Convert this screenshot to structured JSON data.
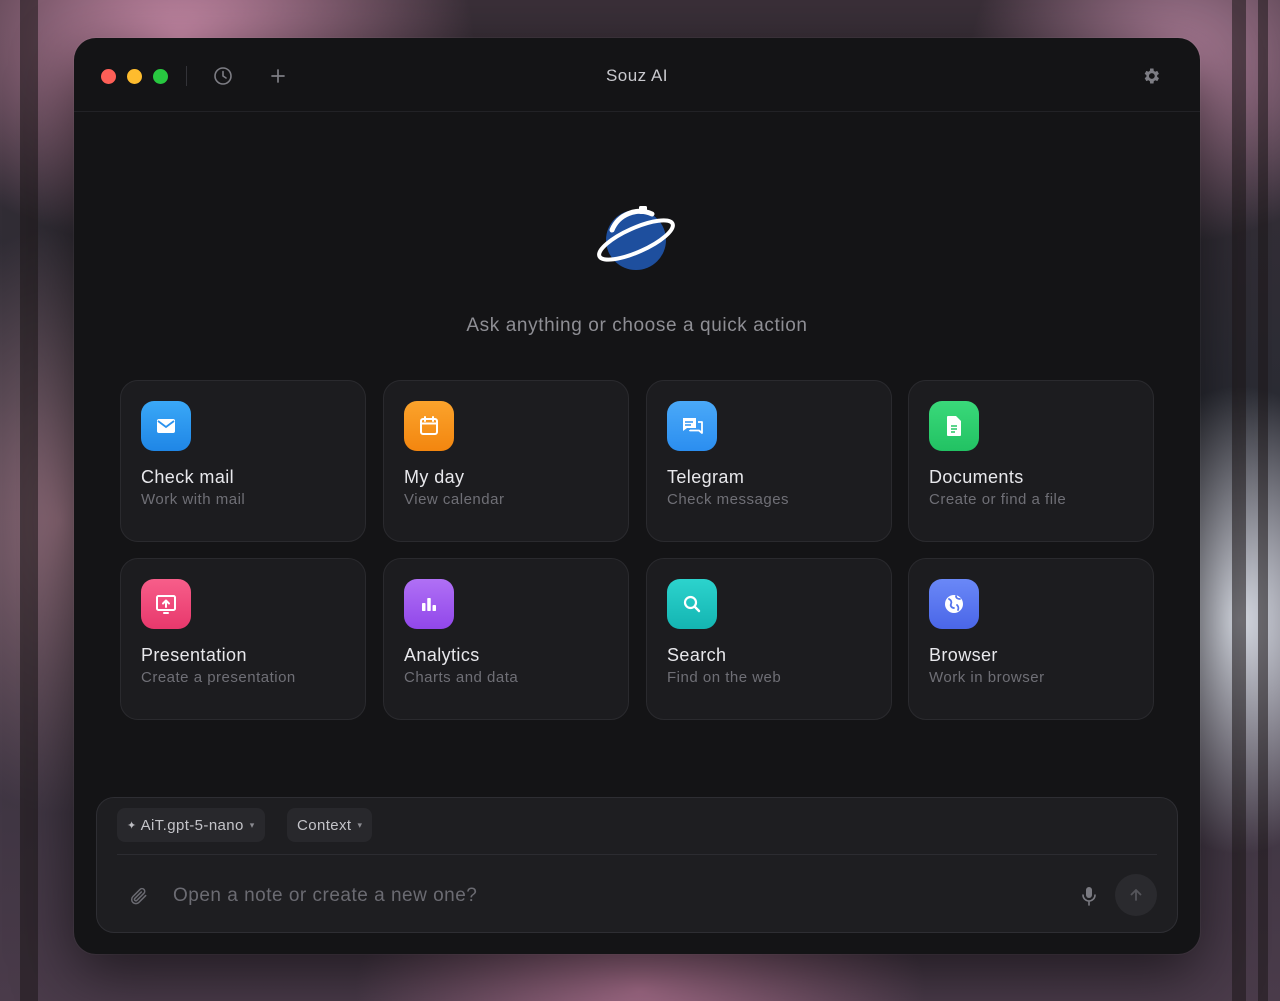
{
  "window": {
    "title": "Souz AI",
    "traffic_lights": [
      "close",
      "minimize",
      "maximize"
    ],
    "toolbar_icons": [
      "history-icon",
      "new-chat-icon",
      "settings-icon"
    ]
  },
  "hero": {
    "logo": "planet-logo",
    "tagline": "Ask anything or choose a quick action"
  },
  "quick_actions": [
    {
      "title": "Check mail",
      "subtitle": "Work with mail",
      "icon": "mail-icon",
      "color": "#2e9df4"
    },
    {
      "title": "My day",
      "subtitle": "View calendar",
      "icon": "calendar-icon",
      "color": "#f7961e"
    },
    {
      "title": "Telegram",
      "subtitle": "Check messages",
      "icon": "chat-icon",
      "color": "#3a9ef5"
    },
    {
      "title": "Documents",
      "subtitle": "Create or find a file",
      "icon": "document-icon",
      "color": "#2fcf6e"
    },
    {
      "title": "Presentation",
      "subtitle": "Create a presentation",
      "icon": "presentation-icon",
      "color": "#f0487a"
    },
    {
      "title": "Analytics",
      "subtitle": "Charts and data",
      "icon": "bar-chart-icon",
      "color": "#a05cf0"
    },
    {
      "title": "Search",
      "subtitle": "Find on the web",
      "icon": "search-icon",
      "color": "#1fc4c0"
    },
    {
      "title": "Browser",
      "subtitle": "Work in browser",
      "icon": "globe-icon",
      "color": "#5a78f0"
    }
  ],
  "composer": {
    "model_label": "AiT.gpt-5-nano",
    "context_label": "Context",
    "placeholder": "Open a note or create a new one?",
    "value": ""
  }
}
